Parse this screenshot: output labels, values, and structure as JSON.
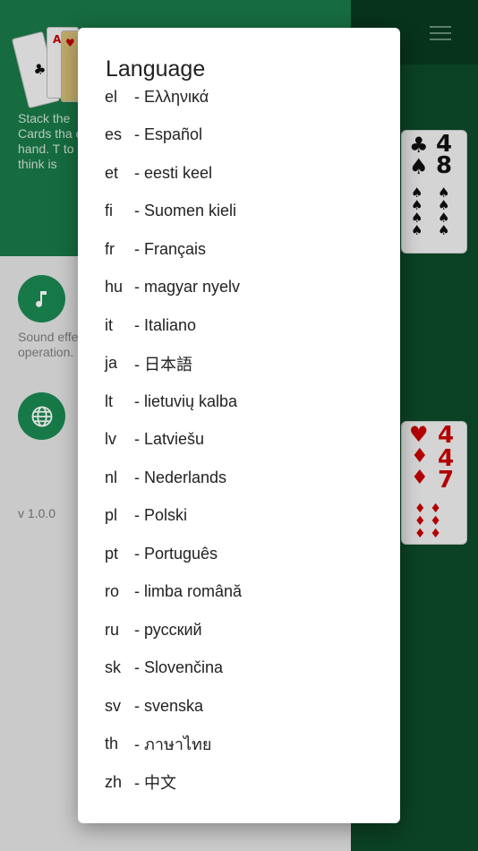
{
  "background": {
    "intro_text": "Stack the Cards tha on hand. T to think is",
    "sound_text": "Sound effe operation.",
    "version": "v 1.0.0"
  },
  "cards": {
    "clubs": {
      "rank": "4",
      "rank2": "8",
      "suit_top": "♣",
      "suit_second": "♠"
    },
    "hearts": {
      "rank": "4",
      "rank2": "4",
      "rank3": "7",
      "suit_top": "♥",
      "suit_second": "♦"
    }
  },
  "dialog": {
    "title": "Language",
    "items": [
      {
        "code": "el",
        "name": "- Ελληνικά"
      },
      {
        "code": "es",
        "name": "- Español"
      },
      {
        "code": "et",
        "name": "- eesti keel"
      },
      {
        "code": "fi",
        "name": "- Suomen kieli"
      },
      {
        "code": "fr",
        "name": "- Français"
      },
      {
        "code": "hu",
        "name": "- magyar nyelv"
      },
      {
        "code": "it",
        "name": "- Italiano"
      },
      {
        "code": "ja",
        "name": "- 日本語"
      },
      {
        "code": "lt",
        "name": "- lietuvių kalba"
      },
      {
        "code": "lv",
        "name": "- Latviešu"
      },
      {
        "code": "nl",
        "name": "- Nederlands"
      },
      {
        "code": "pl",
        "name": "- Polski"
      },
      {
        "code": "pt",
        "name": "- Português"
      },
      {
        "code": "ro",
        "name": "- limba română"
      },
      {
        "code": "ru",
        "name": "- русский"
      },
      {
        "code": "sk",
        "name": "- Slovenčina"
      },
      {
        "code": "sv",
        "name": "- svenska"
      },
      {
        "code": "th",
        "name": "- ภาษาไทย"
      },
      {
        "code": "zh",
        "name": "- 中文"
      }
    ]
  },
  "colors": {
    "green_top": "#1a7a48",
    "green_dark": "#0d4a29",
    "icon_green": "#1c8a52",
    "dialog_bg": "#ffffff"
  },
  "icons": {
    "music": "music-note-icon",
    "globe": "globe-icon",
    "menu": "hamburger-menu-icon"
  }
}
